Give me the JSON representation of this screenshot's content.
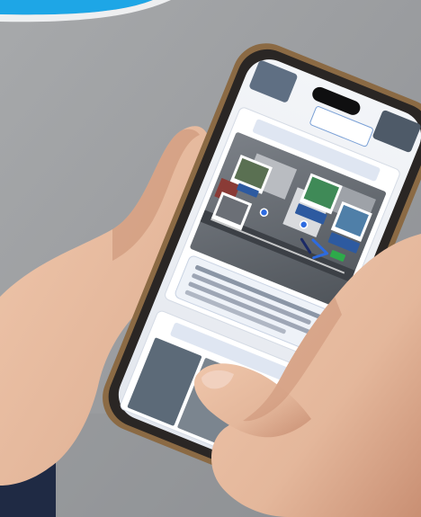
{
  "photo": {
    "subject": "hands-holding-smartphone",
    "colors": {
      "background": "#9a9c9f",
      "background_dark": "#7f8286",
      "corner_accent": "#1ea6e6",
      "phone_body": "#2a2624",
      "phone_rim": "#8b6a44",
      "screen_bg": "#eef1f5",
      "skin": "#e4b79b",
      "skin_shadow": "#c98f73",
      "sleeve": "#1f2a44",
      "card_blue": "#2d5aa0",
      "map_gray": "#6b7077",
      "pin_blue": "#2d6be0",
      "pin_green": "#2eaa4a"
    }
  },
  "screen": {
    "top_note": "",
    "card_title": "",
    "map_labels": [],
    "bottom_title": ""
  }
}
